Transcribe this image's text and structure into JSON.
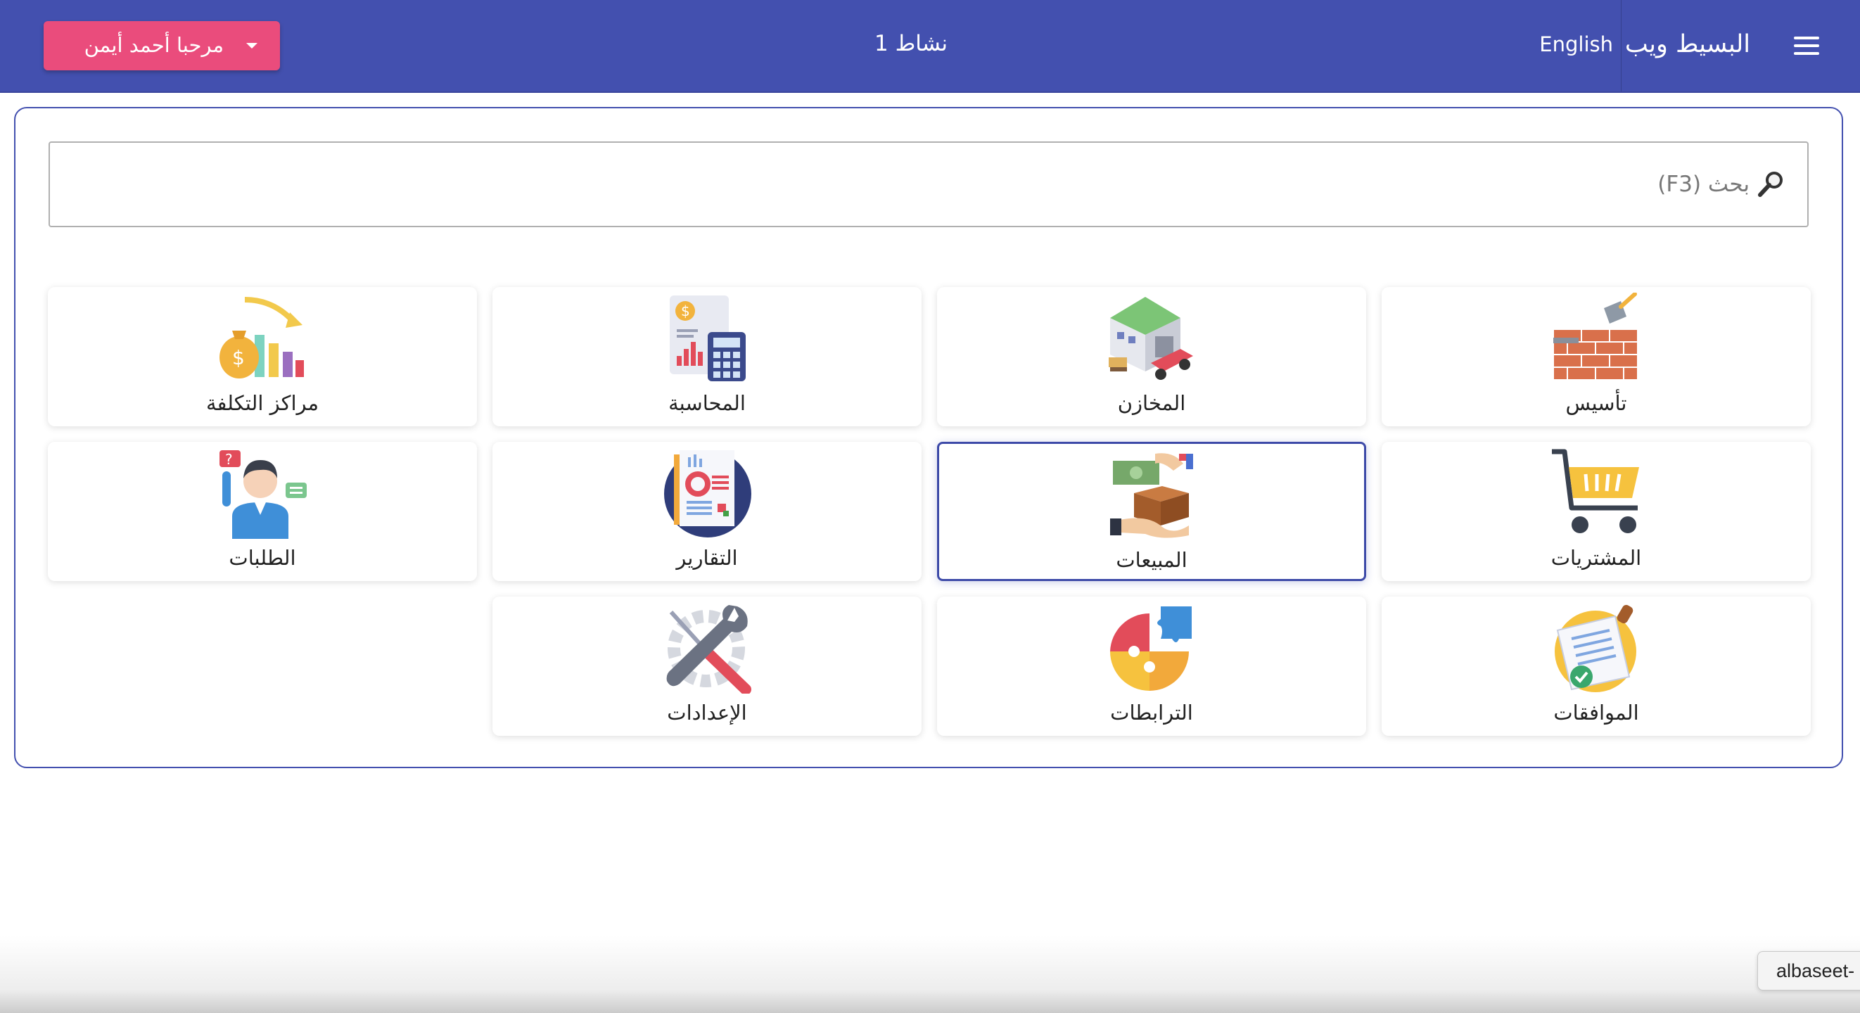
{
  "header": {
    "brand": "البسيط ويب",
    "language_link": "English",
    "activity": "نشاط 1",
    "user_menu_label": "مرحبا أحمد أيمن",
    "bar_color": "#4350af",
    "user_button_color": "#ea4c7c"
  },
  "search": {
    "placeholder": "بحث (F3)"
  },
  "modules": [
    {
      "label": "تأسيس",
      "icon": "brick-wall-trowel-icon"
    },
    {
      "label": "المخازن",
      "icon": "warehouse-truck-icon"
    },
    {
      "label": "المحاسبة",
      "icon": "calculator-report-icon"
    },
    {
      "label": "مراكز التكلفة",
      "icon": "money-bag-chart-icon"
    },
    {
      "label": "المشتريات",
      "icon": "shopping-cart-icon",
      "selected": false
    },
    {
      "label": "المبيعات",
      "icon": "cash-box-hand-icon",
      "selected": true
    },
    {
      "label": "التقارير",
      "icon": "report-documents-icon"
    },
    {
      "label": "الطلبات",
      "icon": "support-person-icon"
    },
    {
      "label": "الموافقات",
      "icon": "approved-document-icon"
    },
    {
      "label": "الترابطات",
      "icon": "puzzle-pieces-icon"
    },
    {
      "label": "الإعدادات",
      "icon": "wrench-screwdriver-gear-icon"
    }
  ],
  "status_tooltip": "albaseet-"
}
